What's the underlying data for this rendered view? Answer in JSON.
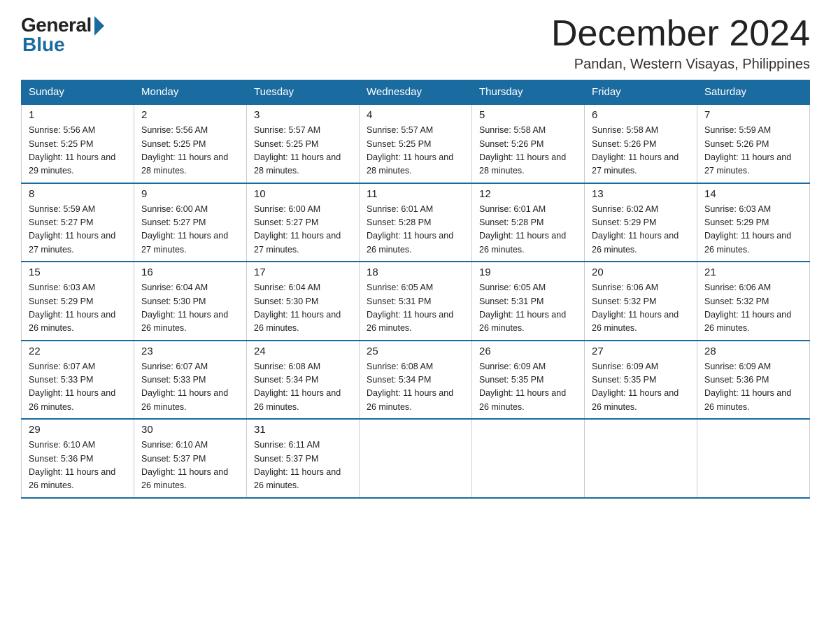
{
  "logo": {
    "general": "General",
    "blue": "Blue"
  },
  "title": "December 2024",
  "location": "Pandan, Western Visayas, Philippines",
  "headers": [
    "Sunday",
    "Monday",
    "Tuesday",
    "Wednesday",
    "Thursday",
    "Friday",
    "Saturday"
  ],
  "weeks": [
    [
      {
        "day": "1",
        "sunrise": "Sunrise: 5:56 AM",
        "sunset": "Sunset: 5:25 PM",
        "daylight": "Daylight: 11 hours and 29 minutes."
      },
      {
        "day": "2",
        "sunrise": "Sunrise: 5:56 AM",
        "sunset": "Sunset: 5:25 PM",
        "daylight": "Daylight: 11 hours and 28 minutes."
      },
      {
        "day": "3",
        "sunrise": "Sunrise: 5:57 AM",
        "sunset": "Sunset: 5:25 PM",
        "daylight": "Daylight: 11 hours and 28 minutes."
      },
      {
        "day": "4",
        "sunrise": "Sunrise: 5:57 AM",
        "sunset": "Sunset: 5:25 PM",
        "daylight": "Daylight: 11 hours and 28 minutes."
      },
      {
        "day": "5",
        "sunrise": "Sunrise: 5:58 AM",
        "sunset": "Sunset: 5:26 PM",
        "daylight": "Daylight: 11 hours and 28 minutes."
      },
      {
        "day": "6",
        "sunrise": "Sunrise: 5:58 AM",
        "sunset": "Sunset: 5:26 PM",
        "daylight": "Daylight: 11 hours and 27 minutes."
      },
      {
        "day": "7",
        "sunrise": "Sunrise: 5:59 AM",
        "sunset": "Sunset: 5:26 PM",
        "daylight": "Daylight: 11 hours and 27 minutes."
      }
    ],
    [
      {
        "day": "8",
        "sunrise": "Sunrise: 5:59 AM",
        "sunset": "Sunset: 5:27 PM",
        "daylight": "Daylight: 11 hours and 27 minutes."
      },
      {
        "day": "9",
        "sunrise": "Sunrise: 6:00 AM",
        "sunset": "Sunset: 5:27 PM",
        "daylight": "Daylight: 11 hours and 27 minutes."
      },
      {
        "day": "10",
        "sunrise": "Sunrise: 6:00 AM",
        "sunset": "Sunset: 5:27 PM",
        "daylight": "Daylight: 11 hours and 27 minutes."
      },
      {
        "day": "11",
        "sunrise": "Sunrise: 6:01 AM",
        "sunset": "Sunset: 5:28 PM",
        "daylight": "Daylight: 11 hours and 26 minutes."
      },
      {
        "day": "12",
        "sunrise": "Sunrise: 6:01 AM",
        "sunset": "Sunset: 5:28 PM",
        "daylight": "Daylight: 11 hours and 26 minutes."
      },
      {
        "day": "13",
        "sunrise": "Sunrise: 6:02 AM",
        "sunset": "Sunset: 5:29 PM",
        "daylight": "Daylight: 11 hours and 26 minutes."
      },
      {
        "day": "14",
        "sunrise": "Sunrise: 6:03 AM",
        "sunset": "Sunset: 5:29 PM",
        "daylight": "Daylight: 11 hours and 26 minutes."
      }
    ],
    [
      {
        "day": "15",
        "sunrise": "Sunrise: 6:03 AM",
        "sunset": "Sunset: 5:29 PM",
        "daylight": "Daylight: 11 hours and 26 minutes."
      },
      {
        "day": "16",
        "sunrise": "Sunrise: 6:04 AM",
        "sunset": "Sunset: 5:30 PM",
        "daylight": "Daylight: 11 hours and 26 minutes."
      },
      {
        "day": "17",
        "sunrise": "Sunrise: 6:04 AM",
        "sunset": "Sunset: 5:30 PM",
        "daylight": "Daylight: 11 hours and 26 minutes."
      },
      {
        "day": "18",
        "sunrise": "Sunrise: 6:05 AM",
        "sunset": "Sunset: 5:31 PM",
        "daylight": "Daylight: 11 hours and 26 minutes."
      },
      {
        "day": "19",
        "sunrise": "Sunrise: 6:05 AM",
        "sunset": "Sunset: 5:31 PM",
        "daylight": "Daylight: 11 hours and 26 minutes."
      },
      {
        "day": "20",
        "sunrise": "Sunrise: 6:06 AM",
        "sunset": "Sunset: 5:32 PM",
        "daylight": "Daylight: 11 hours and 26 minutes."
      },
      {
        "day": "21",
        "sunrise": "Sunrise: 6:06 AM",
        "sunset": "Sunset: 5:32 PM",
        "daylight": "Daylight: 11 hours and 26 minutes."
      }
    ],
    [
      {
        "day": "22",
        "sunrise": "Sunrise: 6:07 AM",
        "sunset": "Sunset: 5:33 PM",
        "daylight": "Daylight: 11 hours and 26 minutes."
      },
      {
        "day": "23",
        "sunrise": "Sunrise: 6:07 AM",
        "sunset": "Sunset: 5:33 PM",
        "daylight": "Daylight: 11 hours and 26 minutes."
      },
      {
        "day": "24",
        "sunrise": "Sunrise: 6:08 AM",
        "sunset": "Sunset: 5:34 PM",
        "daylight": "Daylight: 11 hours and 26 minutes."
      },
      {
        "day": "25",
        "sunrise": "Sunrise: 6:08 AM",
        "sunset": "Sunset: 5:34 PM",
        "daylight": "Daylight: 11 hours and 26 minutes."
      },
      {
        "day": "26",
        "sunrise": "Sunrise: 6:09 AM",
        "sunset": "Sunset: 5:35 PM",
        "daylight": "Daylight: 11 hours and 26 minutes."
      },
      {
        "day": "27",
        "sunrise": "Sunrise: 6:09 AM",
        "sunset": "Sunset: 5:35 PM",
        "daylight": "Daylight: 11 hours and 26 minutes."
      },
      {
        "day": "28",
        "sunrise": "Sunrise: 6:09 AM",
        "sunset": "Sunset: 5:36 PM",
        "daylight": "Daylight: 11 hours and 26 minutes."
      }
    ],
    [
      {
        "day": "29",
        "sunrise": "Sunrise: 6:10 AM",
        "sunset": "Sunset: 5:36 PM",
        "daylight": "Daylight: 11 hours and 26 minutes."
      },
      {
        "day": "30",
        "sunrise": "Sunrise: 6:10 AM",
        "sunset": "Sunset: 5:37 PM",
        "daylight": "Daylight: 11 hours and 26 minutes."
      },
      {
        "day": "31",
        "sunrise": "Sunrise: 6:11 AM",
        "sunset": "Sunset: 5:37 PM",
        "daylight": "Daylight: 11 hours and 26 minutes."
      },
      null,
      null,
      null,
      null
    ]
  ],
  "accent_color": "#1a6ba0"
}
